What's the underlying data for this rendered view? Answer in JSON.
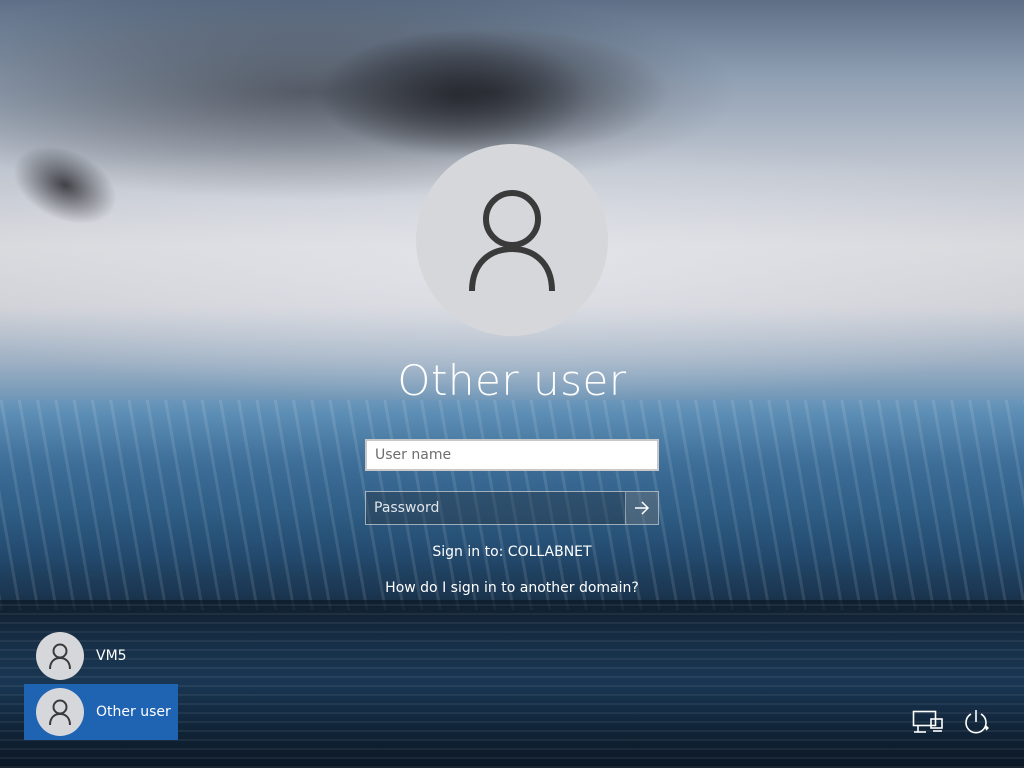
{
  "login": {
    "title": "Other user",
    "username_placeholder": "User name",
    "password_placeholder": "Password",
    "sign_in_to": "Sign in to: COLLABNET",
    "domain_help_link": "How do I sign in to another domain?"
  },
  "users": [
    {
      "label": "VM5",
      "selected": false
    },
    {
      "label": "Other user",
      "selected": true
    }
  ],
  "icons": {
    "avatar": "user-silhouette-icon",
    "submit": "arrow-right-icon",
    "network": "network-icon",
    "power": "power-icon"
  },
  "colors": {
    "selected_tile": "#1f63b3",
    "avatar_bg": "#d6d7da"
  }
}
